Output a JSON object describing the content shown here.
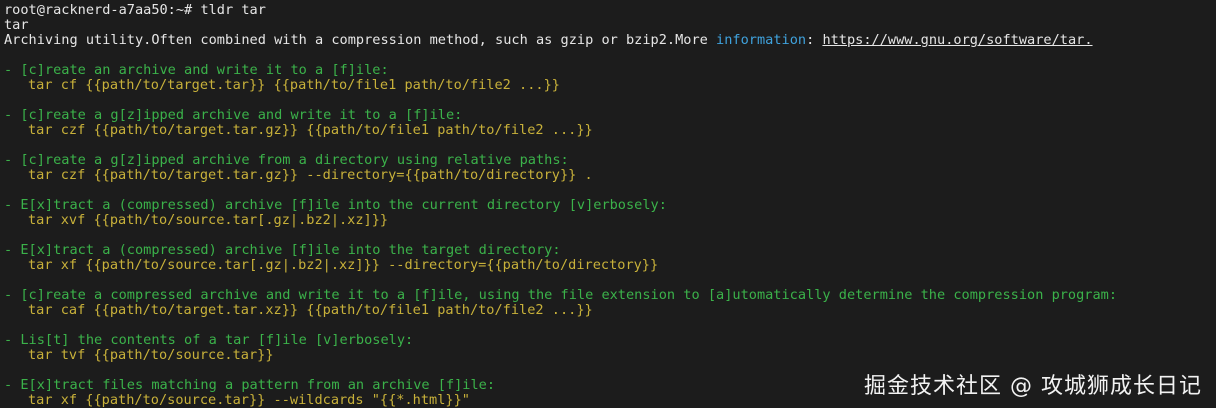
{
  "terminal": {
    "top_partial": "",
    "prompt": "root@racknerd-a7aa50:~#",
    "command": "tldr tar",
    "page_name": "tar",
    "description_text": "Archiving utility.Often combined with a compression method, such as gzip or bzip2.More ",
    "description_info_word": "information",
    "description_colon": ": ",
    "description_url": "https://www.gnu.org/software/tar.",
    "examples": [
      {
        "desc": "- [c]reate an archive and write it to a [f]ile:",
        "cmd": "tar cf {{path/to/target.tar}} {{path/to/file1 path/to/file2 ...}}"
      },
      {
        "desc": "- [c]reate a g[z]ipped archive and write it to a [f]ile:",
        "cmd": "tar czf {{path/to/target.tar.gz}} {{path/to/file1 path/to/file2 ...}}"
      },
      {
        "desc": "- [c]reate a g[z]ipped archive from a directory using relative paths:",
        "cmd": "tar czf {{path/to/target.tar.gz}} --directory={{path/to/directory}} ."
      },
      {
        "desc": "- E[x]tract a (compressed) archive [f]ile into the current directory [v]erbosely:",
        "cmd": "tar xvf {{path/to/source.tar[.gz|.bz2|.xz]}}"
      },
      {
        "desc": "- E[x]tract a (compressed) archive [f]ile into the target directory:",
        "cmd": "tar xf {{path/to/source.tar[.gz|.bz2|.xz]}} --directory={{path/to/directory}}"
      },
      {
        "desc": "- [c]reate a compressed archive and write it to a [f]ile, using the file extension to [a]utomatically determine the compression program:",
        "cmd": "tar caf {{path/to/target.tar.xz}} {{path/to/file1 path/to/file2 ...}}"
      },
      {
        "desc": "- Lis[t] the contents of a tar [f]ile [v]erbosely:",
        "cmd": "tar tvf {{path/to/source.tar}}"
      },
      {
        "desc": "- E[x]tract files matching a pattern from an archive [f]ile:",
        "cmd": "tar xf {{path/to/source.tar}} --wildcards \"{{*.html}}\""
      }
    ]
  },
  "watermark": "掘金技术社区 @ 攻城狮成长日记",
  "colors": {
    "background": "#1c1c1c",
    "text": "#e6e6e6",
    "description_green": "#3bb24a",
    "command_yellow": "#c8b13a",
    "info_blue": "#3fa2dd"
  }
}
